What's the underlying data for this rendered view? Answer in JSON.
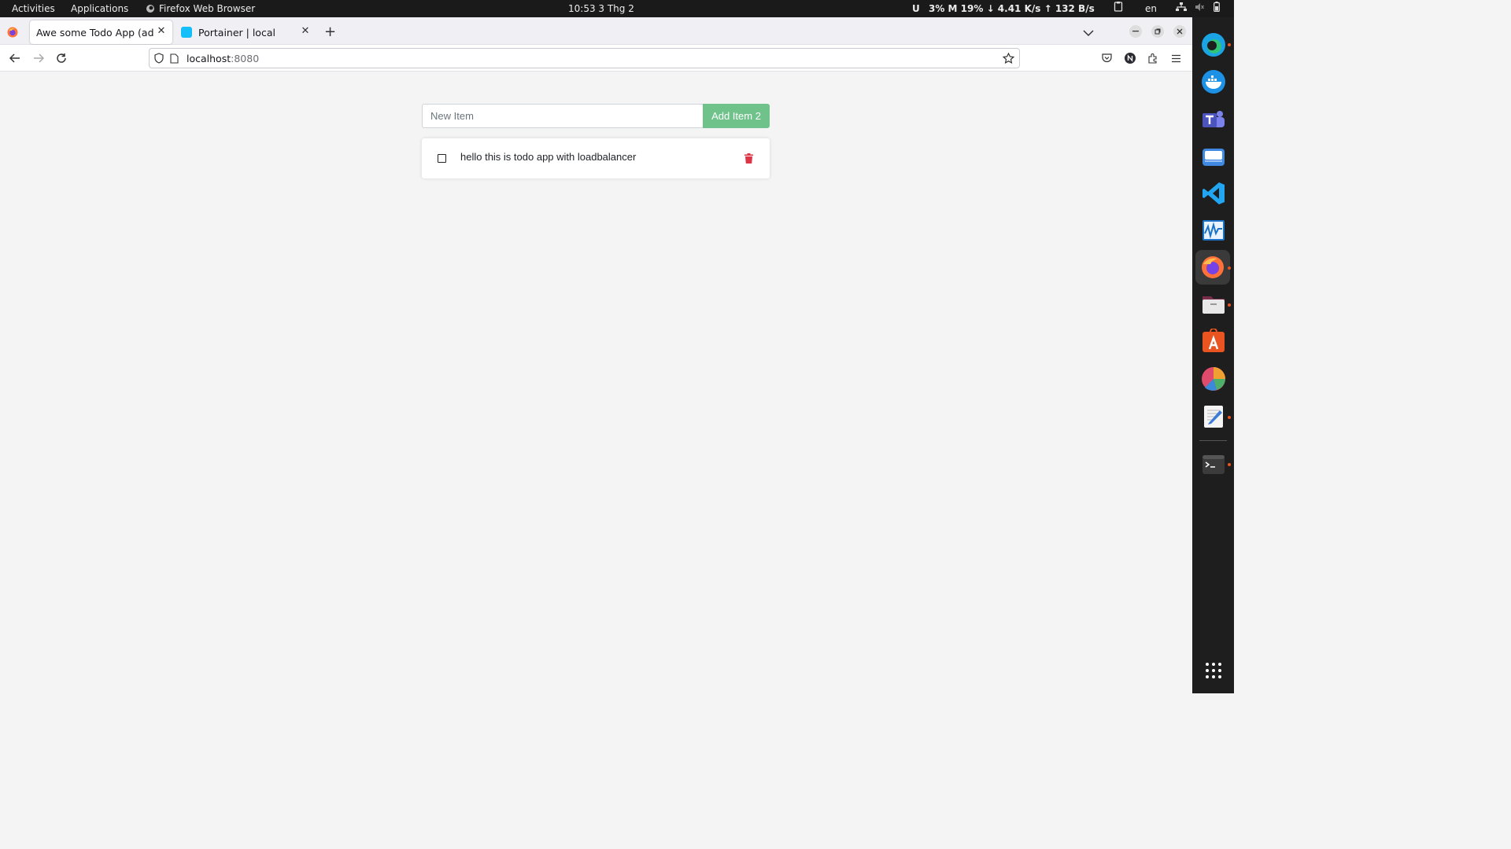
{
  "topbar": {
    "activities": "Activities",
    "applications": "Applications",
    "app_name": "Firefox Web Browser",
    "clock": "10:53  3 Thg 2",
    "indicator_u": "U",
    "indicator_stats": "3% M  19% ↓ 4.41 K/s ↑  132 B/s",
    "lang": "en"
  },
  "browser": {
    "tabs": [
      {
        "label": "Awe some Todo App (add ca",
        "active": true
      },
      {
        "label": "Portainer | local",
        "active": false
      }
    ],
    "url_host": "localhost",
    "url_port": ":8080"
  },
  "todo_app": {
    "input_placeholder": "New Item",
    "input_value": "",
    "add_button_label": "Add Item 2",
    "items": [
      {
        "text": "hello this is todo app with loadbalancer",
        "completed": false
      }
    ],
    "colors": {
      "add_button": "#6fc38a",
      "delete_icon": "#dc3545",
      "page_background": "#f4f4f4"
    }
  },
  "dock": {
    "apps": [
      "microsoft-edge-icon",
      "docker-icon",
      "teams-icon",
      "mail-icon",
      "vscode-icon",
      "system-monitor-icon",
      "firefox-icon",
      "files-icon",
      "app-center-icon",
      "chart-app-icon",
      "text-editor-icon",
      "terminal-icon",
      "show-apps-icon"
    ]
  }
}
